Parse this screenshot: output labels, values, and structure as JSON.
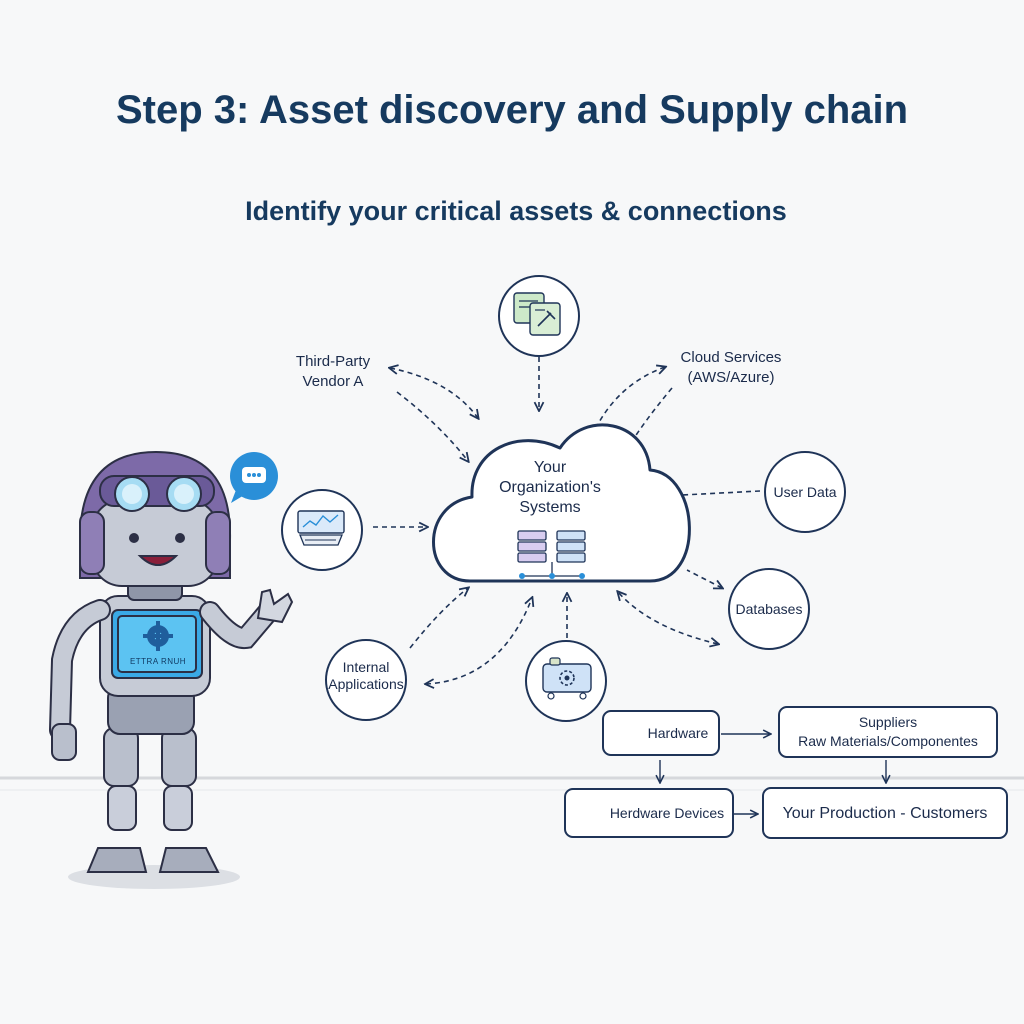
{
  "title": "Step 3: Asset discovery and Supply chain",
  "subtitle": "Identify your critical assets & connections",
  "center": {
    "line1": "Your",
    "line2": "Organization's",
    "line3": "Systems",
    "icon": "server-network-icon"
  },
  "nodes": {
    "third_party": {
      "line1": "Third-Party",
      "line2": "Vendor A"
    },
    "cloud_services": {
      "line1": "Cloud Services",
      "line2": "(AWS/Azure)"
    },
    "user_data": "User Data",
    "databases": "Databases",
    "internal_apps": {
      "line1": "Internal",
      "line2": "Applications"
    },
    "top_icon": "documents-tools-icon",
    "left_icon": "monitor-chart-icon",
    "bottom_icon": "machine-gear-icon"
  },
  "supply_chain": {
    "hardware": "Hardware",
    "suppliers_line1": "Suppliers",
    "suppliers_line2": "Raw Materials/Componentes",
    "hardware_devices": "Herdware Devices",
    "production": "Your Production - Customers"
  },
  "robot": {
    "screen_text": "ETTRA RNUH",
    "chat_icon": "chat-bubble-icon"
  },
  "colors": {
    "navy": "#1f3458",
    "accent_blue": "#2a8fd8",
    "robot_purple": "#7d6aa8",
    "robot_gray": "#b9bfcc"
  }
}
